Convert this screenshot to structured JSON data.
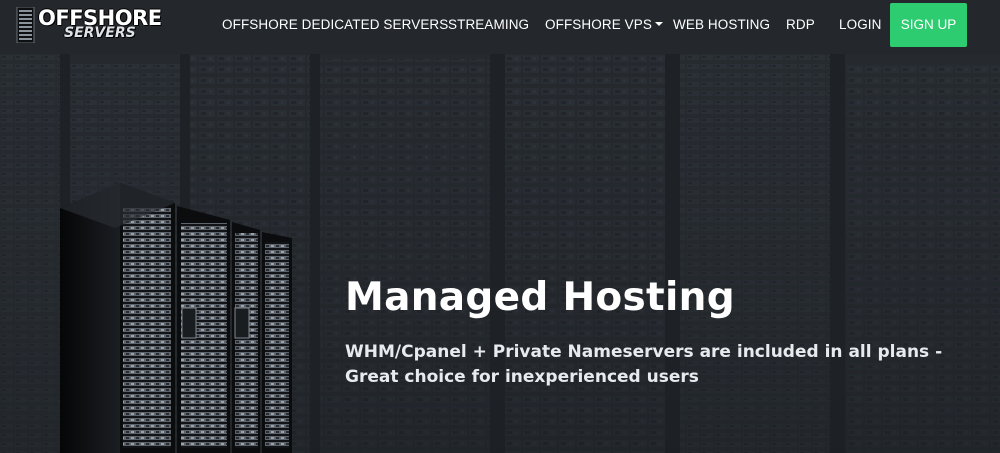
{
  "brand": {
    "logo_line1": "OFFSHORE",
    "logo_line2": "SERVERS",
    "logo_icon": "server-tower-icon"
  },
  "nav": {
    "items": [
      {
        "label": "OFFSHORE DEDICATED SERVERS"
      },
      {
        "label": "STREAMING"
      },
      {
        "label": "OFFSHORE VPS",
        "dropdown": true
      },
      {
        "label": "WEB HOSTING"
      },
      {
        "label": "RDP"
      },
      {
        "label": "LOGIN"
      }
    ],
    "signup_label": "SIGN UP"
  },
  "hero": {
    "title": "Managed Hosting",
    "subtitle": "WHM/Cpanel + Private Nameservers are included in all plans - Great choice for inexperienced users",
    "illustration": "server-racks"
  },
  "colors": {
    "header_bg": "#24282c",
    "hero_bg": "#2b3035",
    "signup": "#2ecc71",
    "text": "#ffffff"
  }
}
